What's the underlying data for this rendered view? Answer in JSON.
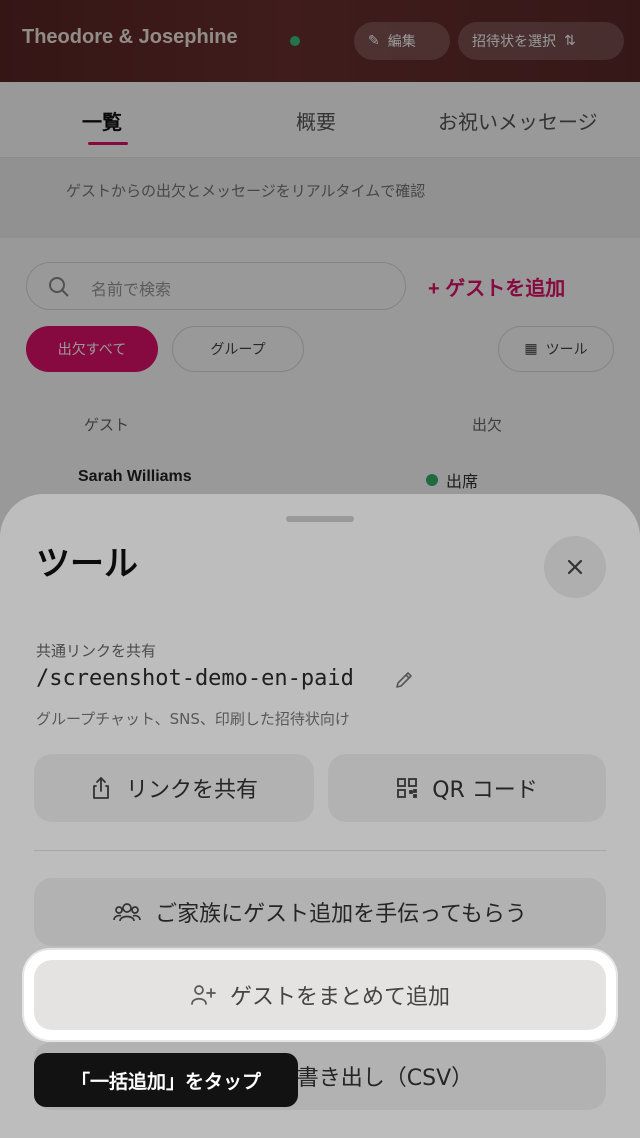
{
  "header": {
    "title": "Theodore & Josephine",
    "edit_label": "編集",
    "switch_label": "招待状を選択"
  },
  "tabs": [
    {
      "label": "一覧"
    },
    {
      "label": "概要"
    },
    {
      "label": "お祝いメッセージ"
    }
  ],
  "info_bar": {
    "text": "ゲストからの出欠とメッセージをリアルタイムで確認"
  },
  "search": {
    "placeholder": "名前で検索"
  },
  "add_guest_label": "+ ゲストを追加",
  "filters": {
    "all_label": "出欠すべて",
    "group_label": "グループ",
    "tools_label": "ツール"
  },
  "table": {
    "columns": [
      "ゲスト",
      "出欠"
    ],
    "rows": [
      {
        "name": "Sarah Williams",
        "status": "出席"
      }
    ]
  },
  "sheet": {
    "title": "ツール",
    "share_link_label": "共通リンクを共有",
    "share_path": "/screenshot-demo-en-paid",
    "share_desc": "グループチャット、SNS、印刷した招待状向け",
    "share_button": "リンクを共有",
    "qr_button": "QR コード",
    "family_button": "ご家族にゲスト追加を手伝ってもらう",
    "bulk_add_button": "ゲストをまとめて追加",
    "export_button_tail": "書き出し（CSV）"
  },
  "tooltip": {
    "text": "「一括追加」をタップ"
  },
  "colors": {
    "accent": "#e0116a",
    "online": "#36c37a",
    "header": "#5a2424"
  }
}
